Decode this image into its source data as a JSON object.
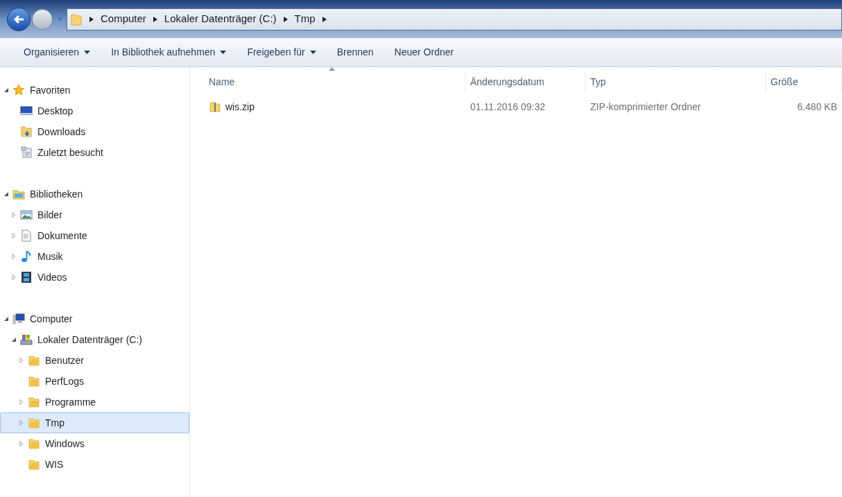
{
  "address_bar": {
    "crumbs": [
      "Computer",
      "Lokaler Datenträger (C:)",
      "Tmp"
    ]
  },
  "toolbar": [
    {
      "label": "Organisieren",
      "dropdown": true
    },
    {
      "label": "In Bibliothek aufnehmen",
      "dropdown": true
    },
    {
      "label": "Freigeben für",
      "dropdown": true
    },
    {
      "label": "Brennen",
      "dropdown": false
    },
    {
      "label": "Neuer Ordner",
      "dropdown": false
    }
  ],
  "sidebar": [
    {
      "label": "Favoriten",
      "kind": "star",
      "expanded": true,
      "selected": false,
      "children": [
        {
          "label": "Desktop",
          "kind": "desktop",
          "selected": false
        },
        {
          "label": "Downloads",
          "kind": "downloads",
          "selected": false
        },
        {
          "label": "Zuletzt besucht",
          "kind": "recent",
          "selected": false
        }
      ]
    },
    {
      "label": "Bibliotheken",
      "kind": "library",
      "expanded": true,
      "selected": false,
      "children": [
        {
          "label": "Bilder",
          "kind": "pictures",
          "expanded": false,
          "selected": false
        },
        {
          "label": "Dokumente",
          "kind": "documents",
          "expanded": false,
          "selected": false
        },
        {
          "label": "Musik",
          "kind": "music",
          "expanded": false,
          "selected": false
        },
        {
          "label": "Videos",
          "kind": "videos",
          "expanded": false,
          "selected": false
        }
      ]
    },
    {
      "label": "Computer",
      "kind": "computer",
      "expanded": true,
      "selected": false,
      "children": [
        {
          "label": "Lokaler Datenträger (C:)",
          "kind": "drive",
          "expanded": true,
          "selected": false,
          "children": [
            {
              "label": "Benutzer",
              "kind": "folder",
              "expanded": false,
              "selected": false
            },
            {
              "label": "PerfLogs",
              "kind": "folder",
              "selected": false
            },
            {
              "label": "Programme",
              "kind": "folder",
              "expanded": false,
              "selected": false
            },
            {
              "label": "Tmp",
              "kind": "folder",
              "expanded": false,
              "selected": true
            },
            {
              "label": "Windows",
              "kind": "folder",
              "expanded": false,
              "selected": false
            },
            {
              "label": "WIS",
              "kind": "folder",
              "selected": false
            }
          ]
        }
      ]
    }
  ],
  "table": {
    "columns": [
      "Name",
      "Änderungsdatum",
      "Typ",
      "Größe"
    ],
    "rows": [
      {
        "name": "wis.zip",
        "kind": "zip",
        "date": "01.11.2016 09:32",
        "type": "ZIP-komprimierter Ordner",
        "size": "6.480 KB",
        "selected": false
      }
    ]
  }
}
